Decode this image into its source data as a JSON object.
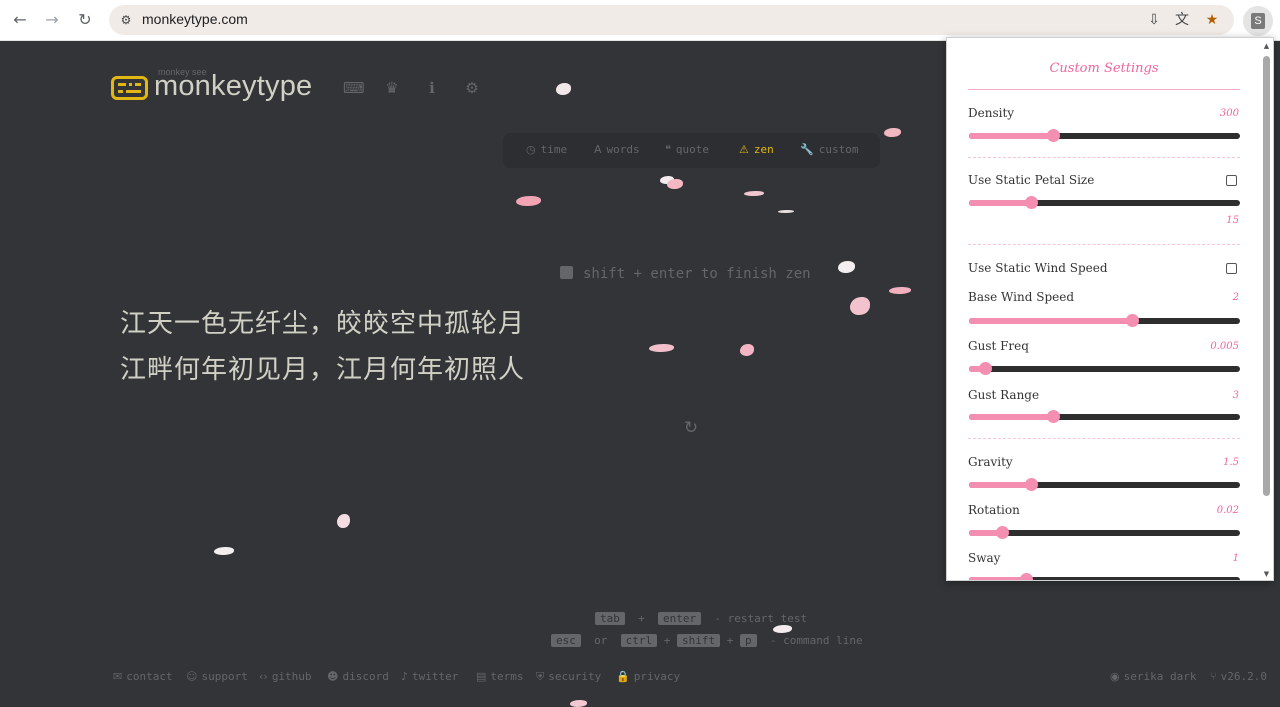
{
  "browser": {
    "url": "monkeytype.com",
    "extension_letter": "S"
  },
  "header": {
    "logo_small": "monkey see",
    "logo_text": "monkeytype"
  },
  "modes": [
    {
      "label": "time",
      "icon": "clock-icon"
    },
    {
      "label": "words",
      "icon": "font-icon"
    },
    {
      "label": "quote",
      "icon": "quote-icon"
    },
    {
      "label": "zen",
      "icon": "warning-icon",
      "active": true
    },
    {
      "label": "custom",
      "icon": "wrench-icon"
    }
  ],
  "zen_hint": "shift + enter to finish zen",
  "typed_text": [
    "江天一色无纤尘，皎皎空中孤轮月",
    "江畔何年初见月，江月何年初照人"
  ],
  "keys": {
    "tab": "tab",
    "plus": "+",
    "enter": "enter",
    "restart_text": "- restart test",
    "esc": "esc",
    "or": "or",
    "ctrl": "ctrl",
    "shift": "shift",
    "p": "p",
    "command_text": "- command line"
  },
  "footer": {
    "links": [
      {
        "label": "contact",
        "icon": "envelope-icon"
      },
      {
        "label": "support",
        "icon": "donate-icon"
      },
      {
        "label": "github",
        "icon": "code-icon"
      },
      {
        "label": "discord",
        "icon": "discord-icon"
      },
      {
        "label": "twitter",
        "icon": "twitter-icon"
      },
      {
        "label": "terms",
        "icon": "file-icon"
      },
      {
        "label": "security",
        "icon": "shield-icon"
      },
      {
        "label": "privacy",
        "icon": "lock-icon"
      }
    ],
    "theme": "serika dark",
    "version": "v26.2.0"
  },
  "settings": {
    "title": "Custom Settings",
    "density": {
      "label": "Density",
      "value": "300",
      "fraction": 0.31
    },
    "static_petal_size": {
      "label": "Use Static Petal Size",
      "checked": false,
      "value": "15",
      "fraction": 0.23
    },
    "static_wind_speed": {
      "label": "Use Static Wind Speed",
      "checked": false
    },
    "base_wind_speed": {
      "label": "Base Wind Speed",
      "value": "2",
      "fraction": 0.6
    },
    "gust_freq": {
      "label": "Gust Freq",
      "value": "0.005",
      "fraction": 0.06
    },
    "gust_range": {
      "label": "Gust Range",
      "value": "3",
      "fraction": 0.31
    },
    "gravity": {
      "label": "Gravity",
      "value": "1.5",
      "fraction": 0.23
    },
    "rotation": {
      "label": "Rotation",
      "value": "0.02",
      "fraction": 0.12
    },
    "sway": {
      "label": "Sway",
      "value": "1",
      "fraction": 0.21
    }
  },
  "colors": {
    "background": "#323437",
    "main": "#e2b714",
    "text": "#d1d0c5",
    "sub": "#646669",
    "accent_pink": "#f0679a",
    "slider_pink": "#f48fb1"
  }
}
